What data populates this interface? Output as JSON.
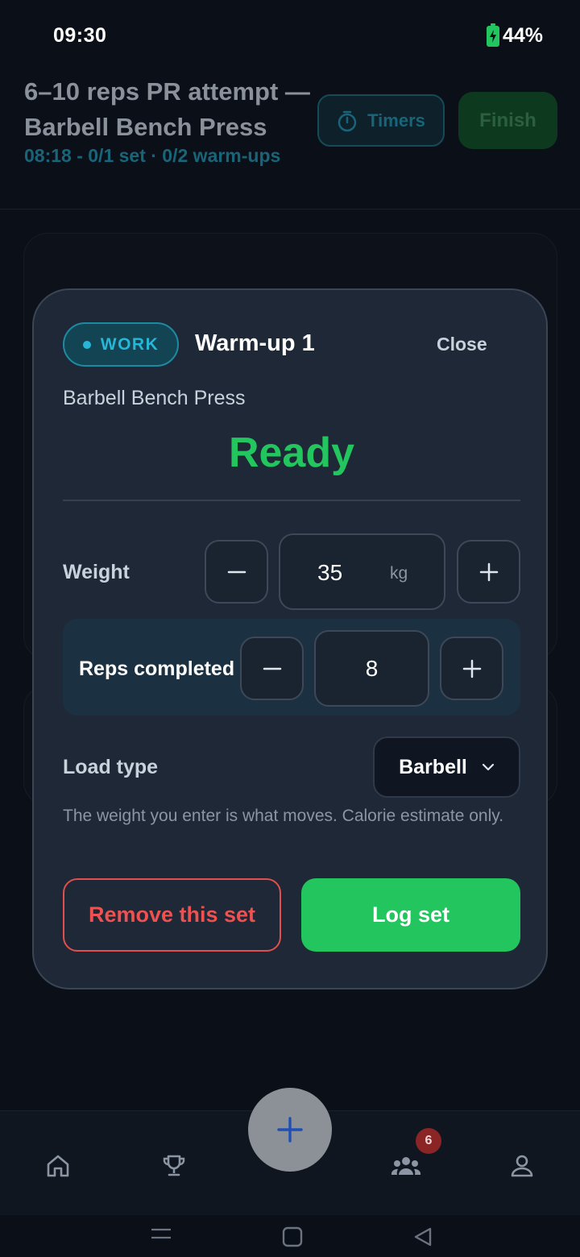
{
  "status_bar": {
    "time": "09:30",
    "battery": "44%",
    "battery_icon": "battery-charging-icon"
  },
  "background": {
    "title": "6–10 reps PR attempt — Barbell Bench Press",
    "subtitle": "08:18 - 0/1 set · 0/2 warm-ups",
    "timers_label": "Timers",
    "timers_icon": "stopwatch-icon",
    "finish_label": "Finish"
  },
  "modal": {
    "badge": "WORK",
    "title": "Warm-up 1",
    "close_label": "Close",
    "exercise": "Barbell Bench Press",
    "state": "Ready",
    "weight": {
      "label": "Weight",
      "value": "35",
      "unit": "kg"
    },
    "reps": {
      "label": "Reps completed",
      "value": "8"
    },
    "load_type": {
      "label": "Load type",
      "selected": "Barbell"
    },
    "hint": "The weight you enter is what moves. Calorie estimate only.",
    "remove_label": "Remove this set",
    "log_label": "Log set"
  },
  "bottom_nav": {
    "items": [
      "home-icon",
      "trophy-icon",
      "add-icon",
      "community-icon",
      "profile-icon"
    ],
    "community_badge": "6"
  },
  "colors": {
    "accent_green": "#22c55e",
    "danger_red": "#ef5151",
    "work_cyan": "#27b7d6",
    "modal_bg": "#1e2836",
    "page_bg": "#0b0f17"
  }
}
